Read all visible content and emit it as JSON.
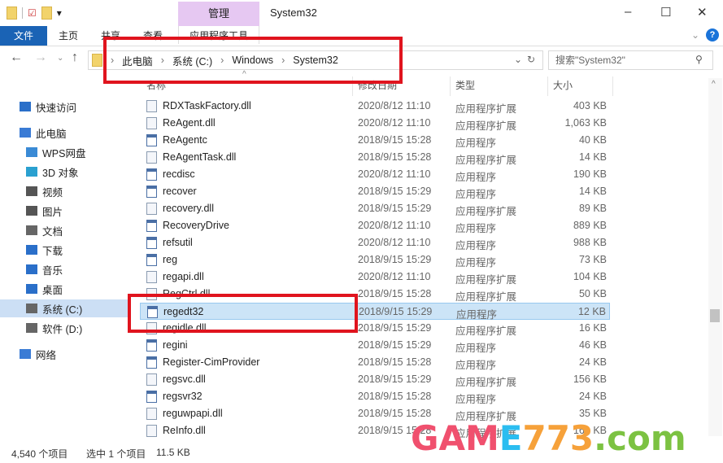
{
  "window": {
    "title": "System32",
    "context_tab": "管理",
    "context_sub": "应用程序工具",
    "controls": [
      "–",
      "☐",
      "✕"
    ]
  },
  "ribbon": {
    "tabs": [
      "文件",
      "主页",
      "共享",
      "查看"
    ]
  },
  "address": {
    "crumbs": [
      "此电脑",
      "系统 (C:)",
      "Windows",
      "System32"
    ],
    "search_placeholder": "搜索\"System32\""
  },
  "columns": {
    "name": "名称",
    "date": "修改日期",
    "type": "类型",
    "size": "大小"
  },
  "sidebar": [
    {
      "label": "快速访问",
      "icon": "star-icon"
    },
    {
      "label": "此电脑",
      "icon": "computer-icon"
    },
    {
      "label": "WPS网盘",
      "icon": "cloud-icon"
    },
    {
      "label": "3D 对象",
      "icon": "cube-icon"
    },
    {
      "label": "视频",
      "icon": "video-icon"
    },
    {
      "label": "图片",
      "icon": "picture-icon"
    },
    {
      "label": "文档",
      "icon": "document-icon"
    },
    {
      "label": "下载",
      "icon": "download-icon"
    },
    {
      "label": "音乐",
      "icon": "music-icon"
    },
    {
      "label": "桌面",
      "icon": "desktop-icon"
    },
    {
      "label": "系统 (C:)",
      "icon": "drive-icon",
      "selected": true
    },
    {
      "label": "软件 (D:)",
      "icon": "drive-icon"
    },
    {
      "label": "网络",
      "icon": "network-icon"
    }
  ],
  "files": [
    {
      "name": "RDXTaskFactory.dll",
      "date": "2020/8/12 11:10",
      "type": "应用程序扩展",
      "size": "403 KB"
    },
    {
      "name": "ReAgent.dll",
      "date": "2020/8/12 11:10",
      "type": "应用程序扩展",
      "size": "1,063 KB"
    },
    {
      "name": "ReAgentc",
      "date": "2018/9/15 15:28",
      "type": "应用程序",
      "size": "40 KB"
    },
    {
      "name": "ReAgentTask.dll",
      "date": "2018/9/15 15:28",
      "type": "应用程序扩展",
      "size": "14 KB"
    },
    {
      "name": "recdisc",
      "date": "2020/8/12 11:10",
      "type": "应用程序",
      "size": "190 KB"
    },
    {
      "name": "recover",
      "date": "2018/9/15 15:29",
      "type": "应用程序",
      "size": "14 KB"
    },
    {
      "name": "recovery.dll",
      "date": "2018/9/15 15:29",
      "type": "应用程序扩展",
      "size": "89 KB"
    },
    {
      "name": "RecoveryDrive",
      "date": "2020/8/12 11:10",
      "type": "应用程序",
      "size": "889 KB"
    },
    {
      "name": "refsutil",
      "date": "2020/8/12 11:10",
      "type": "应用程序",
      "size": "988 KB"
    },
    {
      "name": "reg",
      "date": "2018/9/15 15:29",
      "type": "应用程序",
      "size": "73 KB"
    },
    {
      "name": "regapi.dll",
      "date": "2020/8/12 11:10",
      "type": "应用程序扩展",
      "size": "104 KB"
    },
    {
      "name": "RegCtrl.dll",
      "date": "2018/9/15 15:28",
      "type": "应用程序扩展",
      "size": "50 KB"
    },
    {
      "name": "regedt32",
      "date": "2018/9/15 15:29",
      "type": "应用程序",
      "size": "12 KB",
      "selected": true
    },
    {
      "name": "regidle.dll",
      "date": "2018/9/15 15:29",
      "type": "应用程序扩展",
      "size": "16 KB"
    },
    {
      "name": "regini",
      "date": "2018/9/15 15:29",
      "type": "应用程序",
      "size": "46 KB"
    },
    {
      "name": "Register-CimProvider",
      "date": "2018/9/15 15:28",
      "type": "应用程序",
      "size": "24 KB"
    },
    {
      "name": "regsvc.dll",
      "date": "2018/9/15 15:29",
      "type": "应用程序扩展",
      "size": "156 KB"
    },
    {
      "name": "regsvr32",
      "date": "2018/9/15 15:28",
      "type": "应用程序",
      "size": "24 KB"
    },
    {
      "name": "reguwpapi.dll",
      "date": "2018/9/15 15:28",
      "type": "应用程序扩展",
      "size": "35 KB"
    },
    {
      "name": "ReInfo.dll",
      "date": "2018/9/15 15:28",
      "type": "应用程序扩展",
      "size": "161 KB"
    }
  ],
  "status": {
    "count": "4,540 个项目",
    "selection": "选中 1 个项目",
    "size": "11.5 KB"
  },
  "watermark": "GAME773.com",
  "colors": {
    "accent": "#1a63b5",
    "selection": "#cce4f7",
    "annotation": "#e0141e"
  }
}
